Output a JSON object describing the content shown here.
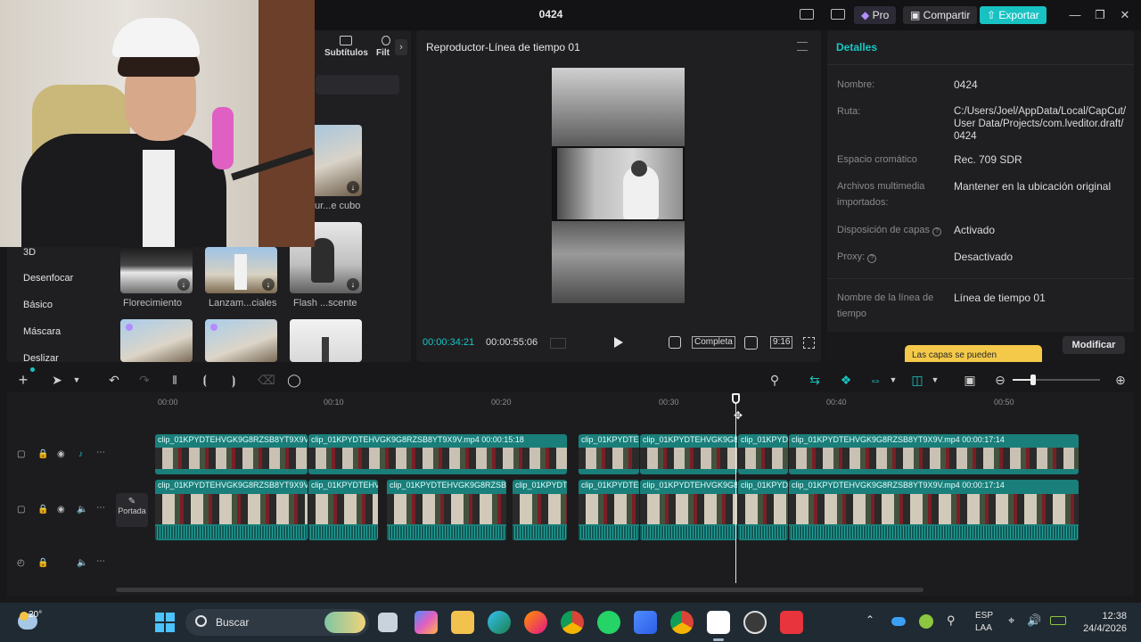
{
  "window": {
    "title": "0424"
  },
  "titlebar": {
    "pro_label": "Pro",
    "share_label": "Compartir",
    "export_label": "Exportar",
    "colors": {
      "export_bg": "#18c2c2",
      "pro_bg": "#2a2a33"
    }
  },
  "left_panel": {
    "tabs": [
      {
        "label": "Subtítulos"
      },
      {
        "label": "Filt"
      }
    ],
    "categories": [
      "3D",
      "Desenfocar",
      "Básico",
      "Máscara",
      "Deslizar"
    ],
    "thumbs_labels": [
      "ur...e cubo",
      "Florecimiento",
      "Lanzam...ciales",
      "Flash ...scente"
    ]
  },
  "player": {
    "title": "Reproductor-Línea de tiempo 01",
    "current_time": "00:00:34:21",
    "total_time": "00:00:55:06",
    "full_label": "Completa",
    "ratio_label": "9:16"
  },
  "details": {
    "title": "Detalles",
    "rows": [
      {
        "label": "Nombre:",
        "value": "0424"
      },
      {
        "label": "Ruta:",
        "value": "C:/Users/Joel/AppData/Local/CapCut/ User Data/Projects/com.lveditor.draft/ 0424"
      },
      {
        "label": "Espacio cromático",
        "value": "Rec. 709 SDR"
      },
      {
        "label": "Archivos multimedia importados:",
        "value": "Mantener en la ubicación original"
      },
      {
        "label": "Disposición de capas",
        "value": "Activado"
      },
      {
        "label": "Proxy:",
        "value": "Desactivado"
      },
      {
        "label": "Nombre de la línea de tiempo",
        "value": "Línea de tiempo 01"
      }
    ],
    "tooltip": "Las capas se pueden",
    "modify_label": "Modificar"
  },
  "timeline": {
    "ruler": [
      "00:00",
      "00:10",
      "00:20",
      "00:30",
      "00:40",
      "00:50"
    ],
    "cover_label": "Portada",
    "playhead_fraction": 0.62,
    "track1_clips": [
      {
        "label": "clip_01KPYDTEHVGK9G8RZSB8YT9X9V"
      },
      {
        "label": "clip_01KPYDTEHVGK9G8RZSB8YT9X9V.mp4  00:00:15:18"
      },
      {
        "label": "clip_01KPYDTE"
      },
      {
        "label": "clip_01KPYDTEHVGK9G8"
      },
      {
        "label": "clip_01KPYD"
      },
      {
        "label": "clip_01KPYDTEHVGK9G8RZSB8YT9X9V.mp4  00:00:17:14"
      }
    ],
    "track2_clips": [
      {
        "label": "clip_01KPYDTEHVGK9G8RZSB8YT9X9V"
      },
      {
        "label": "clip_01KPYDTEHV"
      },
      {
        "label": "clip_01KPYDTEHVGK9G8RZSBE"
      },
      {
        "label": "clip_01KPYDT"
      },
      {
        "label": "clip_01KPYDTE"
      },
      {
        "label": "clip_01KPYDTEHVGK9G8"
      },
      {
        "label": "clip_01KPYD"
      },
      {
        "label": "clip_01KPYDTEHVGK9G8RZSB8YT9X9V.mp4  00:00:17:14"
      }
    ],
    "colors": {
      "clip": "#1a7f7a",
      "clip_dark": "#0f5955",
      "accent": "#19c6c2"
    }
  },
  "taskbar": {
    "weather": "20°",
    "search_placeholder": "Buscar",
    "lang1": "ESP",
    "lang2": "LAA",
    "time": "12:38",
    "date": "24/4/2026"
  }
}
